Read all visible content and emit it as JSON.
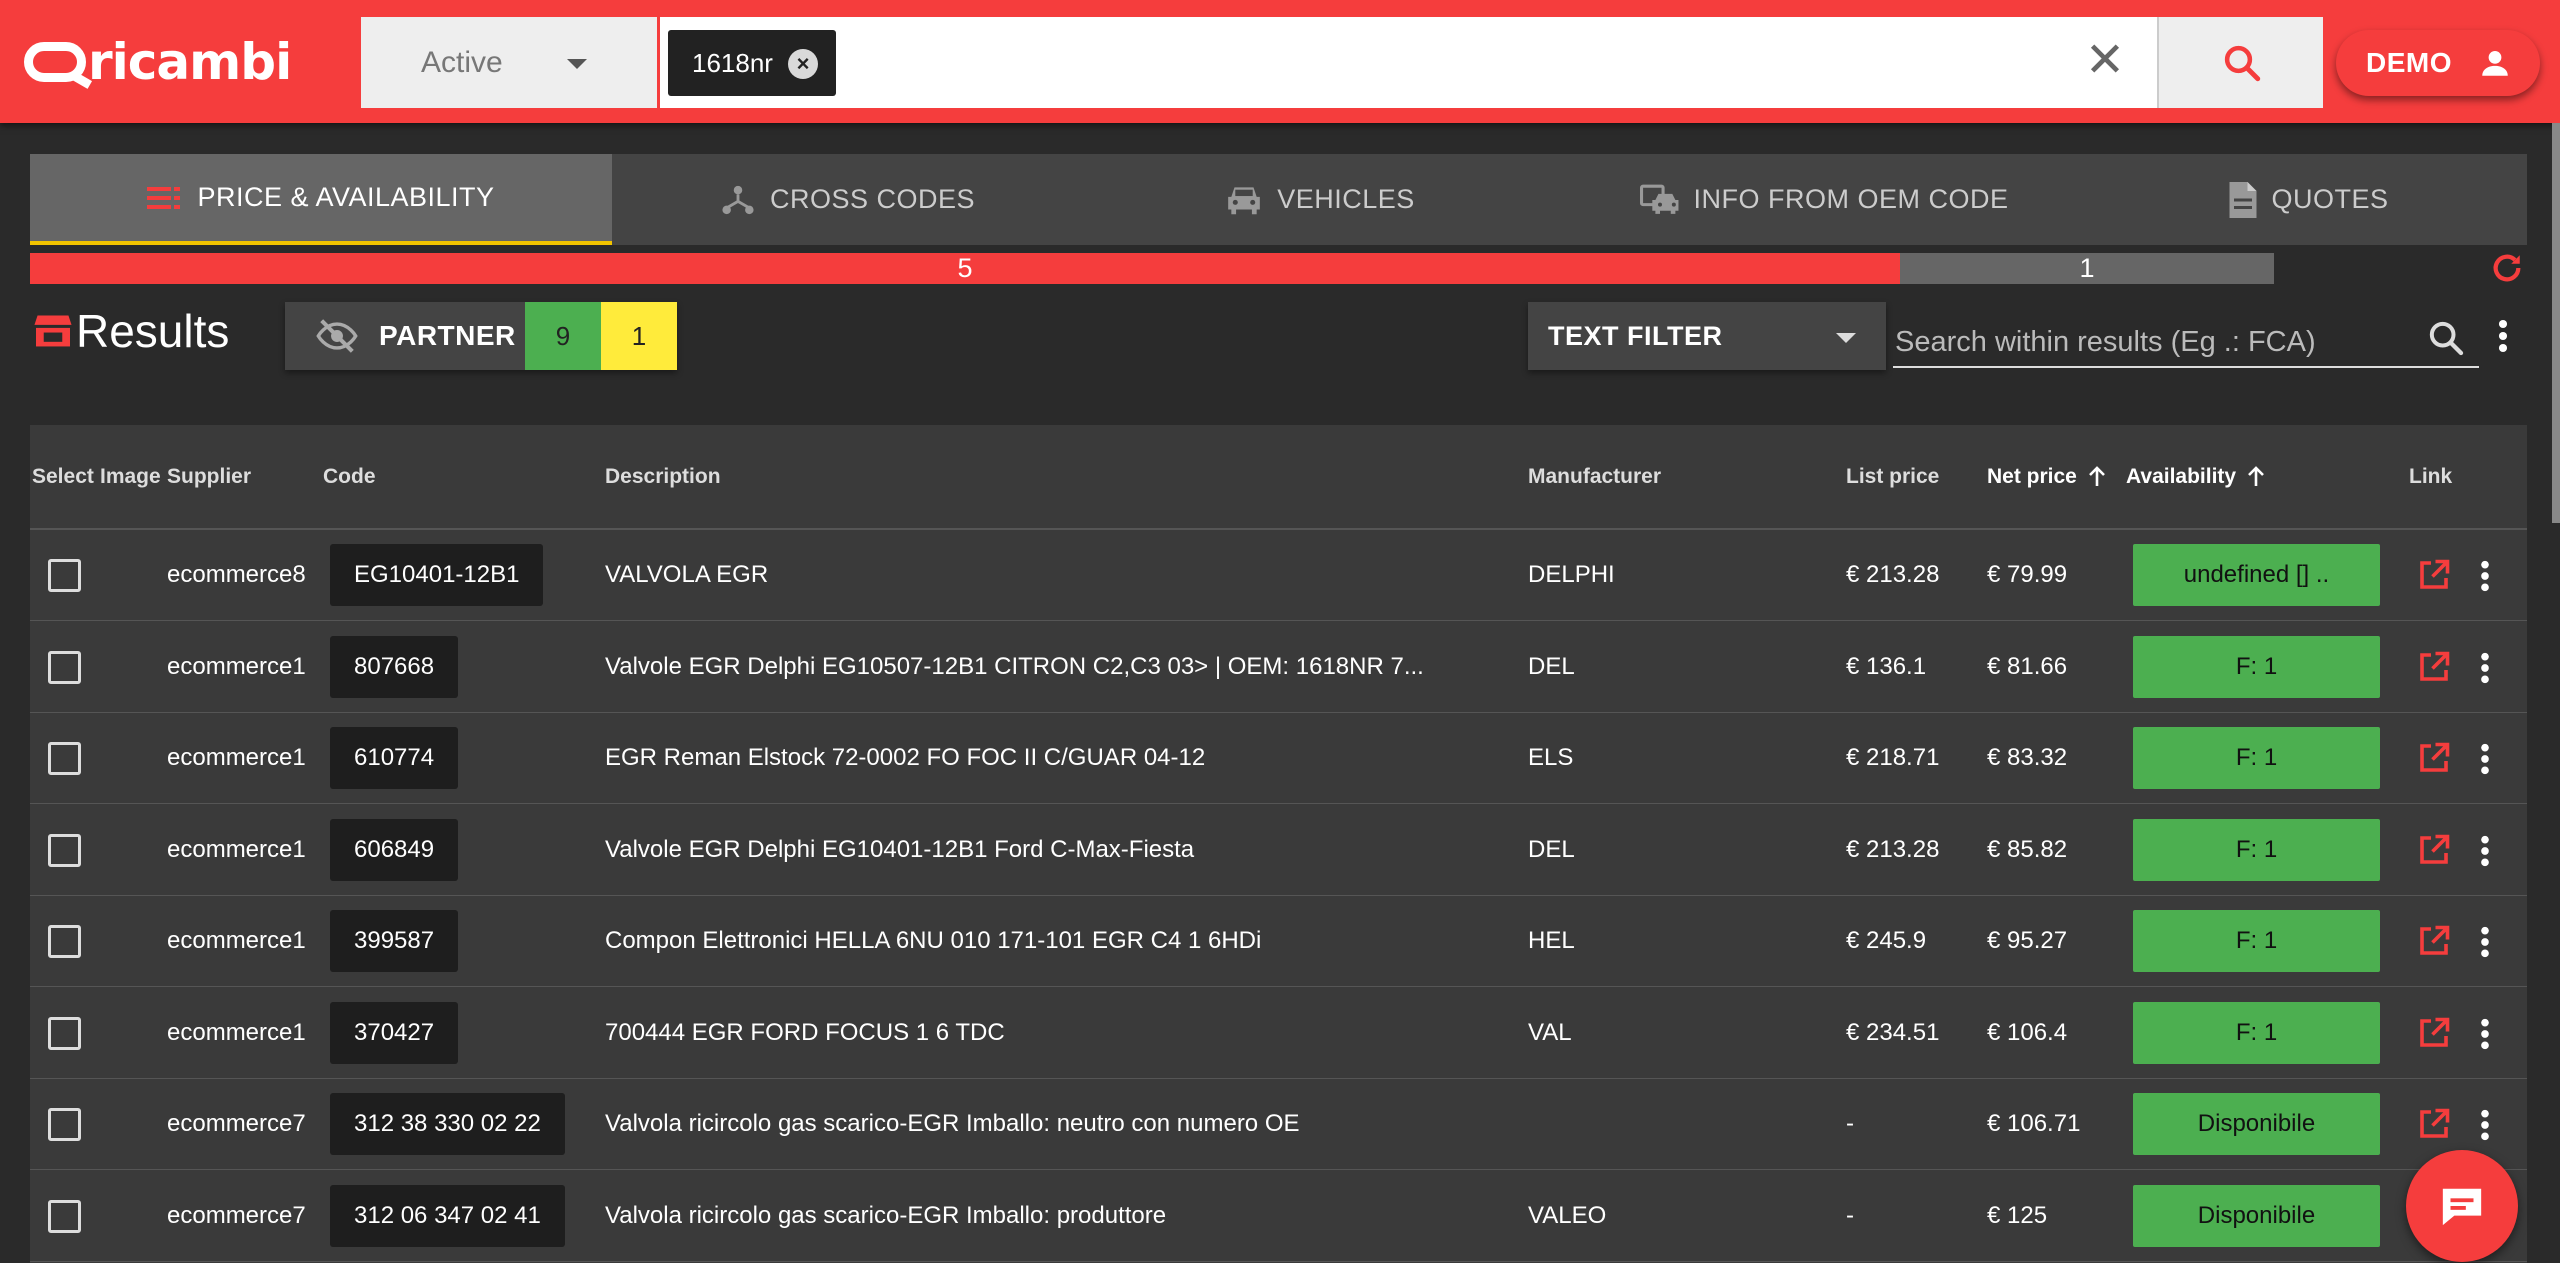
{
  "brand": {
    "logo_text": "ricambi"
  },
  "search": {
    "status_value": "Active",
    "chip": "1618nr",
    "user_label": "DEMO"
  },
  "tabs": [
    {
      "label": "PRICE & AVAILABILITY",
      "icon": "list-icon",
      "active": true
    },
    {
      "label": "CROSS CODES",
      "icon": "hierarchy-icon"
    },
    {
      "label": "VEHICLES",
      "icon": "car-icon"
    },
    {
      "label": "INFO FROM OEM CODE",
      "icon": "truck-car-icon"
    },
    {
      "label": "QUOTES",
      "icon": "document-icon"
    }
  ],
  "progress": {
    "red_count": "5",
    "grey_count": "1",
    "red_fraction": 0.8333
  },
  "results": {
    "title": "Results",
    "partner_label": "PARTNER",
    "green_count": "9",
    "yellow_count": "1",
    "text_filter_label": "TEXT FILTER",
    "search_placeholder": "Search within results (Eg .: FCA)"
  },
  "table": {
    "headers": {
      "select": "Select",
      "image": "Image",
      "supplier": "Supplier",
      "code": "Code",
      "description": "Description",
      "manufacturer": "Manufacturer",
      "list_price": "List price",
      "net_price": "Net price",
      "availability": "Availability",
      "link": "Link"
    },
    "rows": [
      {
        "supplier": "ecommerce8",
        "code": "EG10401-12B1",
        "description": "VALVOLA EGR",
        "manufacturer": "DELPHI",
        "list_price": "€ 213.28",
        "net_price": "€ 79.99",
        "availability": "undefined [] .."
      },
      {
        "supplier": "ecommerce1",
        "code": "807668",
        "description": "Valvole EGR Delphi EG10507-12B1 CITRON C2,C3 03> | OEM: 1618NR 7...",
        "manufacturer": "DEL",
        "list_price": "€ 136.1",
        "net_price": "€ 81.66",
        "availability": "F: 1"
      },
      {
        "supplier": "ecommerce1",
        "code": "610774",
        "description": "EGR Reman Elstock 72-0002 FO FOC II C/GUAR 04-12",
        "manufacturer": "ELS",
        "list_price": "€ 218.71",
        "net_price": "€ 83.32",
        "availability": "F: 1"
      },
      {
        "supplier": "ecommerce1",
        "code": "606849",
        "description": "Valvole EGR Delphi EG10401-12B1 Ford C-Max-Fiesta",
        "manufacturer": "DEL",
        "list_price": "€ 213.28",
        "net_price": "€ 85.82",
        "availability": "F: 1"
      },
      {
        "supplier": "ecommerce1",
        "code": "399587",
        "description": "Compon Elettronici HELLA 6NU 010 171-101 EGR C4 1 6HDi",
        "manufacturer": "HEL",
        "list_price": "€ 245.9",
        "net_price": "€ 95.27",
        "availability": "F: 1"
      },
      {
        "supplier": "ecommerce1",
        "code": "370427",
        "description": "700444 EGR FORD FOCUS 1 6 TDC",
        "manufacturer": "VAL",
        "list_price": "€ 234.51",
        "net_price": "€ 106.4",
        "availability": "F: 1"
      },
      {
        "supplier": "ecommerce7",
        "code": "312 38 330 02 22",
        "description": "Valvola ricircolo gas scarico-EGR Imballo: neutro con numero OE",
        "manufacturer": "",
        "list_price": "-",
        "net_price": "€ 106.71",
        "availability": "Disponibile"
      },
      {
        "supplier": "ecommerce7",
        "code": "312 06 347 02 41",
        "description": "Valvola ricircolo gas scarico-EGR Imballo: produttore",
        "manufacturer": "VALEO",
        "list_price": "-",
        "net_price": "€ 125",
        "availability": "Disponibile"
      }
    ]
  },
  "colors": {
    "brand_red": "#f53d3d",
    "available_green": "#4caf50",
    "partner_yellow": "#ffeb3b",
    "tab_accent": "#f2c400"
  }
}
